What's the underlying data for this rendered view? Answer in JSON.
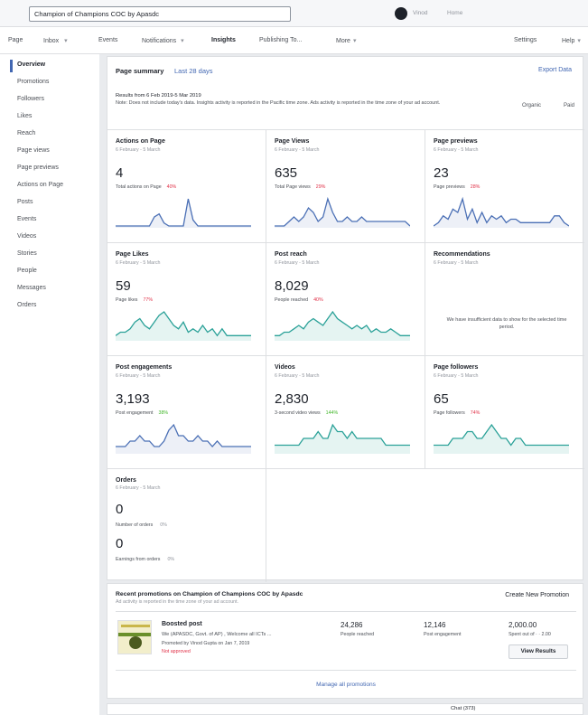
{
  "topbar": {
    "search_value": "Champion of Champions COC by Apasdc",
    "user_name": "Vinod",
    "home": "Home"
  },
  "page_nav": [
    "Page",
    "Inbox",
    "Events",
    "Notifications",
    "Insights",
    "Publishing To...",
    "More",
    "Settings",
    "Help"
  ],
  "left_nav": [
    "Overview",
    "Promotions",
    "Followers",
    "Likes",
    "Reach",
    "Page views",
    "Page previews",
    "Actions on Page",
    "Posts",
    "Events",
    "Videos",
    "Stories",
    "People",
    "Messages",
    "Orders"
  ],
  "summary": {
    "title": "Page summary",
    "period": "Last 28 days",
    "export": "Export Data",
    "results": "Results from 6 Feb 2019-5 Mar 2019",
    "note": "Note: Does not include today's data. Insights activity is reported in the Pacific time zone. Ads activity is reported in the time zone of your ad account.",
    "organic": "Organic",
    "paid": "Paid"
  },
  "cards": [
    {
      "title": "Actions on Page",
      "dates": "6 February - 5 March",
      "value": "4",
      "label": "Total actions on Page",
      "pct": "40%",
      "trend": "down",
      "color": "#4a6fb5",
      "fill": "rgba(74,111,181,0.10)",
      "line": [
        0,
        0,
        0,
        0,
        0,
        0,
        0,
        0,
        3,
        4,
        1,
        0,
        0,
        0,
        0,
        9,
        2,
        0,
        0,
        0,
        0,
        0,
        0,
        0,
        0,
        0,
        0,
        0,
        0
      ]
    },
    {
      "title": "Page Views",
      "dates": "6 February - 5 March",
      "value": "635",
      "label": "Total Page views",
      "pct": "29%",
      "trend": "down",
      "color": "#4a6fb5",
      "fill": "rgba(74,111,181,0.10)",
      "line": [
        0,
        0,
        0,
        1,
        2,
        1,
        2,
        4,
        3,
        1,
        2,
        6,
        3,
        1,
        1,
        2,
        1,
        1,
        2,
        1,
        1,
        1,
        1,
        1,
        1,
        1,
        1,
        1,
        0
      ]
    },
    {
      "title": "Page previews",
      "dates": "6 February - 5 March",
      "value": "23",
      "label": "Page previews",
      "pct": "28%",
      "trend": "down",
      "color": "#4a6fb5",
      "fill": "rgba(74,111,181,0.10)",
      "line": [
        0,
        1,
        3,
        2,
        5,
        4,
        8,
        2,
        5,
        1,
        4,
        1,
        3,
        2,
        3,
        1,
        2,
        2,
        1,
        1,
        1,
        1,
        1,
        1,
        1,
        3,
        3,
        1,
        0
      ]
    },
    {
      "title": "Page Likes",
      "dates": "6 February - 5 March",
      "value": "59",
      "label": "Page likes",
      "pct": "77%",
      "trend": "down",
      "color": "#2aa198",
      "fill": "rgba(42,161,152,0.12)",
      "line": [
        1,
        2,
        2,
        3,
        5,
        6,
        4,
        3,
        5,
        7,
        8,
        6,
        4,
        3,
        5,
        2,
        3,
        2,
        4,
        2,
        3,
        1,
        3,
        1,
        1,
        1,
        1,
        1,
        1
      ]
    },
    {
      "title": "Post reach",
      "dates": "6 February - 5 March",
      "value": "8,029",
      "label": "People reached",
      "pct": "40%",
      "trend": "down",
      "color": "#2aa198",
      "fill": "rgba(42,161,152,0.12)",
      "line": [
        1,
        1,
        2,
        2,
        3,
        4,
        3,
        5,
        6,
        5,
        4,
        6,
        8,
        6,
        5,
        4,
        3,
        4,
        3,
        4,
        2,
        3,
        2,
        2,
        3,
        2,
        1,
        1,
        1
      ]
    },
    {
      "title": "Recommendations",
      "dates": "6 February - 5 March",
      "value": "",
      "label": "",
      "pct": "",
      "trend": "none",
      "color": "#2aa198",
      "fill": "none",
      "line": [],
      "no_data": "We have insufficient data to show for the selected time period."
    },
    {
      "title": "Post engagements",
      "dates": "6 February - 5 March",
      "value": "3,193",
      "label": "Post engagement",
      "pct": "38%",
      "trend": "up",
      "color": "#4a6fb5",
      "fill": "rgba(74,111,181,0.10)",
      "line": [
        1,
        1,
        1,
        2,
        2,
        3,
        2,
        2,
        1,
        1,
        2,
        4,
        5,
        3,
        3,
        2,
        2,
        3,
        2,
        2,
        1,
        2,
        1,
        1,
        1,
        1,
        1,
        1,
        1
      ]
    },
    {
      "title": "Videos",
      "dates": "6 February - 5 March",
      "value": "2,830",
      "label": "3-second video views",
      "pct": "144%",
      "trend": "up",
      "color": "#2aa198",
      "fill": "rgba(42,161,152,0.12)",
      "line": [
        1,
        1,
        1,
        1,
        1,
        1,
        2,
        2,
        2,
        3,
        2,
        2,
        4,
        3,
        3,
        2,
        3,
        2,
        2,
        2,
        2,
        2,
        2,
        1,
        1,
        1,
        1,
        1,
        1
      ]
    },
    {
      "title": "Page followers",
      "dates": "6 February - 5 March",
      "value": "65",
      "label": "Page followers",
      "pct": "74%",
      "trend": "down",
      "color": "#2aa198",
      "fill": "rgba(42,161,152,0.12)",
      "line": [
        1,
        1,
        1,
        1,
        2,
        2,
        2,
        3,
        3,
        2,
        2,
        3,
        4,
        3,
        2,
        2,
        1,
        2,
        2,
        1,
        1,
        1,
        1,
        1,
        1,
        1,
        1,
        1,
        1
      ]
    }
  ],
  "orders": {
    "title": "Orders",
    "dates": "6 February - 5 March",
    "value1": "0",
    "label1": "Number of orders",
    "pct1": "0%",
    "value2": "0",
    "label2": "Earnings from orders",
    "pct2": "0%"
  },
  "promotions": {
    "title": "Recent promotions on Champion of Champions COC by Apasdc",
    "subtitle": "Ad activity is reported in the time zone of your ad account.",
    "create": "Create New Promotion",
    "item_title": "Boosted post",
    "item_desc": "We (APASDC, Govt. of AP) , Welcome all ICTs ...",
    "item_by": "Promoted by Vinod Gupta on Jan 7, 2019",
    "item_status": "Not approved",
    "reached_value": "24,286",
    "reached_label": "People reached",
    "engagement_value": "12,146",
    "engagement_label": "Post engagement",
    "spent_value": "2,000.00",
    "spent_label": "Spent out of · · 2.00",
    "view_results": "View Results",
    "manage": "Manage all promotions"
  },
  "chat": {
    "label": "Chat (373)"
  }
}
